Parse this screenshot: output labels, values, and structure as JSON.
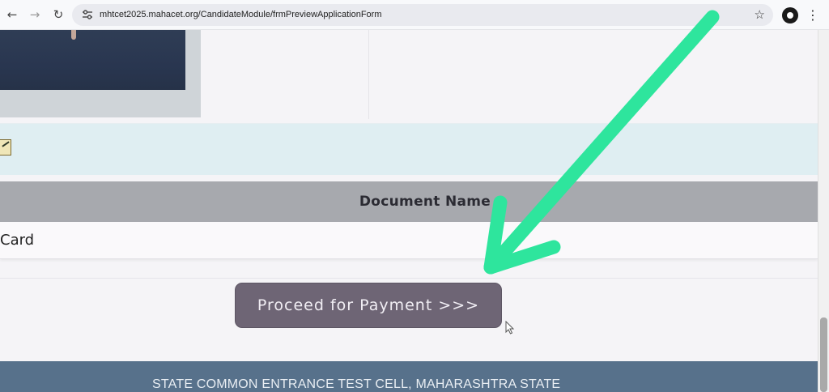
{
  "browser": {
    "url": "mhtcet2025.mahacet.org/CandidateModule/frmPreviewApplicationForm",
    "icons": {
      "back": "back-arrow-icon",
      "forward": "forward-arrow-icon",
      "reload": "reload-icon",
      "site_info": "tune-icon",
      "bookmark": "star-icon",
      "menu": "kebab-menu-icon"
    }
  },
  "documents": {
    "header": "Document Name",
    "rows": [
      "Card"
    ]
  },
  "actions": {
    "proceed_label": "Proceed for Payment >>>"
  },
  "footer": {
    "text": "STATE COMMON ENTRANCE TEST CELL, MAHARASHTRA STATE"
  },
  "annotation": {
    "arrow_color": "#2ee59d"
  },
  "colors": {
    "button_bg": "#6e6575",
    "header_bg": "#a7a9ae",
    "footer_bg": "#57718b",
    "info_band": "#dfeef2"
  }
}
